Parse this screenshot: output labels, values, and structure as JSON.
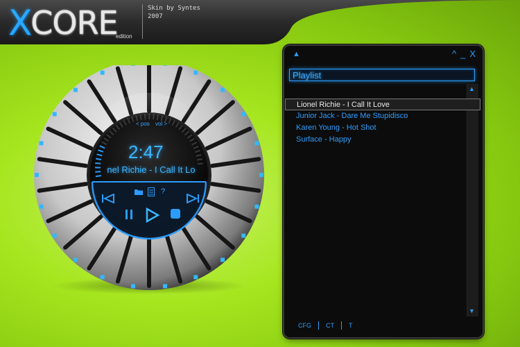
{
  "header": {
    "logo_x": "X",
    "logo_core": "CORE",
    "edition": "edition",
    "credit_line1": "Skin by Syntes",
    "credit_line2": "2007"
  },
  "player": {
    "time": "2:47",
    "now_playing_visible": "nel Richie - I Call It Lo",
    "pos_label": "< pos",
    "vol_label": "vol >",
    "help_label": "?",
    "icons": [
      "previous-icon",
      "next-icon",
      "pause-icon",
      "play-icon",
      "stop-icon",
      "folder-icon",
      "list-icon"
    ]
  },
  "playlist": {
    "title": "Playlist",
    "window_controls": {
      "shade": "^",
      "minimize": "_",
      "close": "X"
    },
    "items": [
      {
        "label": "Lionel Richie - I Call It Love",
        "selected": true
      },
      {
        "label": "Junior Jack - Dare Me Stupidisco",
        "selected": false
      },
      {
        "label": "Karen Young - Hot Shot",
        "selected": false
      },
      {
        "label": "Surface - Happy",
        "selected": false
      }
    ],
    "buttons": [
      "CFG",
      "CT",
      "T"
    ]
  },
  "colors": {
    "accent": "#2a9dff",
    "background_green": "#a6e61f",
    "panel": "#0c0c0c"
  }
}
